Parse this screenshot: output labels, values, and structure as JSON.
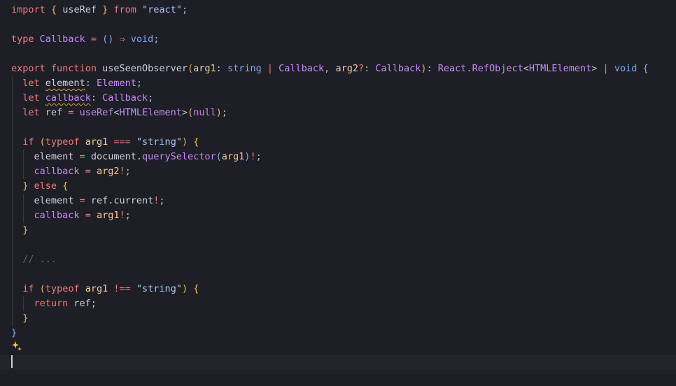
{
  "editor": {
    "language": "typescript",
    "lines": [
      [
        [
          "tok-kw",
          "import"
        ],
        [
          "tok-plain",
          " "
        ],
        [
          "tok-brace",
          "{"
        ],
        [
          "tok-plain",
          " useRef "
        ],
        [
          "tok-brace",
          "}"
        ],
        [
          "tok-plain",
          " "
        ],
        [
          "tok-kw",
          "from"
        ],
        [
          "tok-plain",
          " "
        ],
        [
          "tok-str",
          "\"react\""
        ],
        [
          "tok-punc",
          ";"
        ]
      ],
      [],
      [
        [
          "tok-kw",
          "type"
        ],
        [
          "tok-plain",
          " "
        ],
        [
          "tok-type",
          "Callback"
        ],
        [
          "tok-plain",
          " "
        ],
        [
          "tok-op",
          "="
        ],
        [
          "tok-plain",
          " "
        ],
        [
          "tok-brace2",
          "()"
        ],
        [
          "tok-plain",
          " "
        ],
        [
          "tok-op",
          "⇒"
        ],
        [
          "tok-plain",
          " "
        ],
        [
          "tok-prim",
          "void"
        ],
        [
          "tok-punc",
          ";"
        ]
      ],
      [],
      [
        [
          "tok-kw",
          "export"
        ],
        [
          "tok-plain",
          " "
        ],
        [
          "tok-kw",
          "function"
        ],
        [
          "tok-plain",
          " "
        ],
        [
          "tok-fn",
          "useSeenObserver"
        ],
        [
          "tok-brace",
          "("
        ],
        [
          "tok-var",
          "arg1"
        ],
        [
          "tok-punc",
          ": "
        ],
        [
          "tok-prim",
          "string"
        ],
        [
          "tok-plain",
          " "
        ],
        [
          "tok-op",
          "|"
        ],
        [
          "tok-plain",
          " "
        ],
        [
          "tok-type",
          "Callback"
        ],
        [
          "tok-punc",
          ", "
        ],
        [
          "tok-var",
          "arg2"
        ],
        [
          "tok-op",
          "?"
        ],
        [
          "tok-punc",
          ": "
        ],
        [
          "tok-type",
          "Callback"
        ],
        [
          "tok-brace",
          ")"
        ],
        [
          "tok-punc",
          ": "
        ],
        [
          "tok-type",
          "React.RefObject"
        ],
        [
          "tok-punc",
          "<"
        ],
        [
          "tok-type",
          "HTMLElement"
        ],
        [
          "tok-punc",
          ">"
        ],
        [
          "tok-plain",
          " "
        ],
        [
          "tok-op",
          "|"
        ],
        [
          "tok-plain",
          " "
        ],
        [
          "tok-prim",
          "void"
        ],
        [
          "tok-plain",
          " "
        ],
        [
          "tok-brace2",
          "{"
        ]
      ],
      [
        [
          "tok-plain",
          "  "
        ],
        [
          "tok-kw",
          "let"
        ],
        [
          "tok-plain",
          " "
        ],
        [
          "tok-plain warn",
          "element"
        ],
        [
          "tok-punc",
          ": "
        ],
        [
          "tok-type",
          "Element"
        ],
        [
          "tok-punc",
          ";"
        ]
      ],
      [
        [
          "tok-plain",
          "  "
        ],
        [
          "tok-kw",
          "let"
        ],
        [
          "tok-plain",
          " "
        ],
        [
          "tok-ptxt warn",
          "callback"
        ],
        [
          "tok-punc",
          ": "
        ],
        [
          "tok-type",
          "Callback"
        ],
        [
          "tok-punc",
          ";"
        ]
      ],
      [
        [
          "tok-plain",
          "  "
        ],
        [
          "tok-kw",
          "let"
        ],
        [
          "tok-plain",
          " ref "
        ],
        [
          "tok-op",
          "="
        ],
        [
          "tok-plain",
          " "
        ],
        [
          "tok-call",
          "useRef"
        ],
        [
          "tok-punc",
          "<"
        ],
        [
          "tok-type",
          "HTMLElement"
        ],
        [
          "tok-punc",
          ">"
        ],
        [
          "tok-brace",
          "("
        ],
        [
          "tok-kw2",
          "null"
        ],
        [
          "tok-brace",
          ")"
        ],
        [
          "tok-punc",
          ";"
        ]
      ],
      [],
      [
        [
          "tok-plain",
          "  "
        ],
        [
          "tok-kw",
          "if"
        ],
        [
          "tok-plain",
          " "
        ],
        [
          "tok-brace",
          "("
        ],
        [
          "tok-kw",
          "typeof"
        ],
        [
          "tok-plain",
          " "
        ],
        [
          "tok-var",
          "arg1"
        ],
        [
          "tok-plain",
          " "
        ],
        [
          "tok-op",
          "==="
        ],
        [
          "tok-plain",
          " "
        ],
        [
          "tok-str",
          "\"string\""
        ],
        [
          "tok-brace",
          ")"
        ],
        [
          "tok-plain",
          " "
        ],
        [
          "tok-brace",
          "{"
        ]
      ],
      [
        [
          "tok-plain",
          "    element "
        ],
        [
          "tok-op",
          "="
        ],
        [
          "tok-plain",
          " document."
        ],
        [
          "tok-call",
          "querySelector"
        ],
        [
          "tok-brace2",
          "("
        ],
        [
          "tok-var",
          "arg1"
        ],
        [
          "tok-brace2",
          ")"
        ],
        [
          "tok-op",
          "!"
        ],
        [
          "tok-punc",
          ";"
        ]
      ],
      [
        [
          "tok-plain",
          "    "
        ],
        [
          "tok-ptxt",
          "callback"
        ],
        [
          "tok-plain",
          " "
        ],
        [
          "tok-op",
          "="
        ],
        [
          "tok-plain",
          " "
        ],
        [
          "tok-var",
          "arg2"
        ],
        [
          "tok-op",
          "!"
        ],
        [
          "tok-punc",
          ";"
        ]
      ],
      [
        [
          "tok-plain",
          "  "
        ],
        [
          "tok-brace",
          "}"
        ],
        [
          "tok-plain",
          " "
        ],
        [
          "tok-kw",
          "else"
        ],
        [
          "tok-plain",
          " "
        ],
        [
          "tok-brace",
          "{"
        ]
      ],
      [
        [
          "tok-plain",
          "    element "
        ],
        [
          "tok-op",
          "="
        ],
        [
          "tok-plain",
          " ref.current"
        ],
        [
          "tok-op",
          "!"
        ],
        [
          "tok-punc",
          ";"
        ]
      ],
      [
        [
          "tok-plain",
          "    "
        ],
        [
          "tok-ptxt",
          "callback"
        ],
        [
          "tok-plain",
          " "
        ],
        [
          "tok-op",
          "="
        ],
        [
          "tok-plain",
          " "
        ],
        [
          "tok-var",
          "arg1"
        ],
        [
          "tok-op",
          "!"
        ],
        [
          "tok-punc",
          ";"
        ]
      ],
      [
        [
          "tok-plain",
          "  "
        ],
        [
          "tok-brace",
          "}"
        ]
      ],
      [],
      [
        [
          "tok-plain",
          "  "
        ],
        [
          "tok-cmt",
          "// ..."
        ]
      ],
      [],
      [
        [
          "tok-plain",
          "  "
        ],
        [
          "tok-kw",
          "if"
        ],
        [
          "tok-plain",
          " "
        ],
        [
          "tok-brace",
          "("
        ],
        [
          "tok-kw",
          "typeof"
        ],
        [
          "tok-plain",
          " "
        ],
        [
          "tok-var",
          "arg1"
        ],
        [
          "tok-plain",
          " "
        ],
        [
          "tok-op",
          "!=="
        ],
        [
          "tok-plain",
          " "
        ],
        [
          "tok-str",
          "\"string\""
        ],
        [
          "tok-brace",
          ")"
        ],
        [
          "tok-plain",
          " "
        ],
        [
          "tok-brace",
          "{"
        ]
      ],
      [
        [
          "tok-plain",
          "    "
        ],
        [
          "tok-kw",
          "return"
        ],
        [
          "tok-plain",
          " ref"
        ],
        [
          "tok-punc",
          ";"
        ]
      ],
      [
        [
          "tok-plain",
          "  "
        ],
        [
          "tok-brace",
          "}"
        ]
      ],
      [
        [
          "tok-brace2",
          "}"
        ]
      ],
      [],
      []
    ],
    "guides": [
      {
        "from": 5,
        "to": 21,
        "col": 0
      },
      {
        "from": 10,
        "to": 11,
        "col": 2
      },
      {
        "from": 13,
        "to": 14,
        "col": 2
      },
      {
        "from": 20,
        "to": 20,
        "col": 2
      }
    ],
    "current_line": 24,
    "ai_hint_icon": "sparkle-icon"
  }
}
